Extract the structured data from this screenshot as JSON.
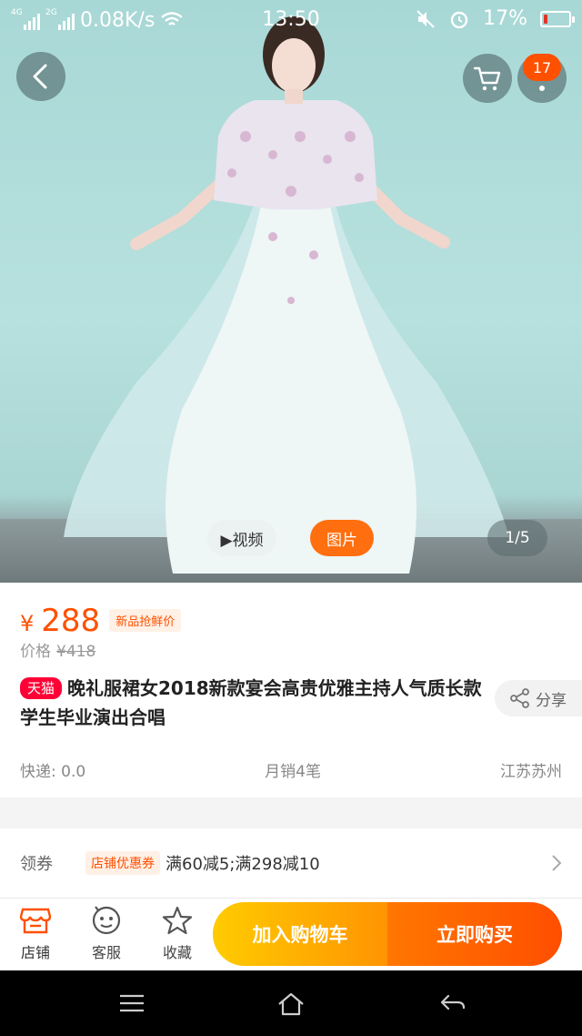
{
  "status_bar": {
    "net1": "4G",
    "net2": "2G",
    "speed": "0.08K/s",
    "time": "13:50",
    "battery": "17%",
    "battery_level": 0.17
  },
  "gallery": {
    "cart_badge": "17",
    "video_label": "▶视频",
    "photo_label": "图片",
    "index": "1/5"
  },
  "product": {
    "currency": "¥",
    "price": "288",
    "price_tag": "新品抢鲜价",
    "orig_label": "价格",
    "orig_price": "¥418",
    "store_badge": "天猫",
    "title": "晚礼服裙女2018新款宴会高贵优雅主持人气质长款学生毕业演出合唱",
    "share": "分享",
    "shipping": "快递: 0.0",
    "sales": "月销4笔",
    "location": "江苏苏州"
  },
  "coupon": {
    "label": "领券",
    "tag": "店铺优惠券",
    "text": "满60减5;满298减10"
  },
  "action_bar": {
    "store": "店铺",
    "service": "客服",
    "favorite": "收藏",
    "add_cart": "加入购物车",
    "buy_now": "立即购买"
  },
  "colors": {
    "accent": "#ff5000",
    "tmall": "#ff0036",
    "cart_btn": "#ffb300",
    "buy_btn": "#ff5a00"
  }
}
